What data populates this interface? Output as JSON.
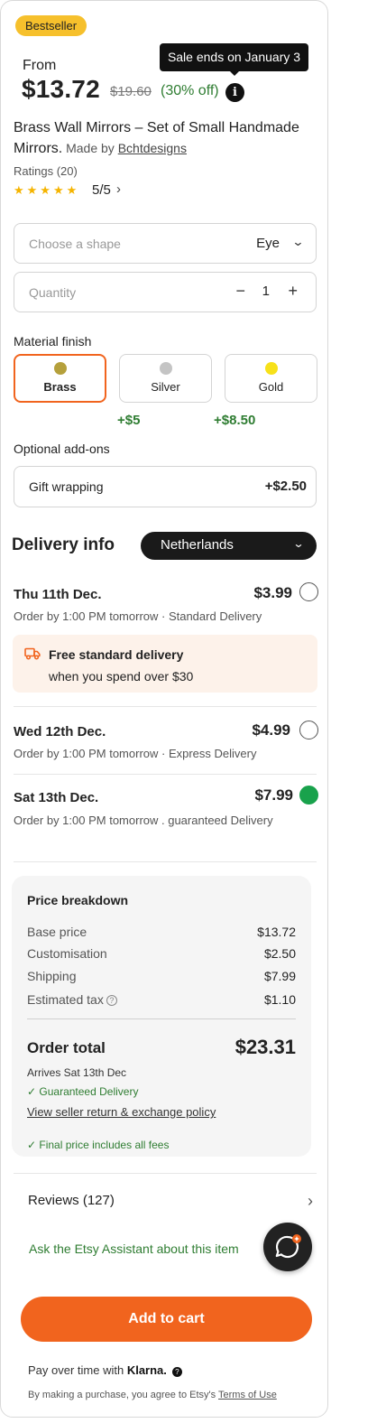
{
  "badge": "Bestseller",
  "tooltip": "Sale ends on January 3",
  "price": {
    "from_label": "From",
    "current": "$13.72",
    "original": "$19.60",
    "discount": "(30% off)",
    "info_icon": "i"
  },
  "product": {
    "title": "Brass Wall Mirrors – Set of Small Handmade Mirrors.",
    "made_by_prefix": " Made by ",
    "maker": "Bchtdesigns"
  },
  "ratings": {
    "label": "Ratings (20)",
    "stars": "★★★★★",
    "value": "5/5",
    "stars_count": 5
  },
  "shape": {
    "placeholder": "Choose a shape",
    "value": "Eye"
  },
  "quantity": {
    "placeholder": "Quantity",
    "value": "1",
    "minus": "−",
    "plus": "+"
  },
  "material": {
    "label": "Material finish",
    "options": [
      {
        "label": "Brass",
        "color": "#b5a03c",
        "selected": true
      },
      {
        "label": "Silver",
        "color": "#c4c4c4",
        "selected": false
      },
      {
        "label": "Gold",
        "color": "#f7e11a",
        "selected": false
      }
    ],
    "surcharges": [
      "+$5",
      "+$8.50"
    ]
  },
  "addons": {
    "label": "Optional add-ons",
    "items": [
      {
        "label": "Gift wrapping",
        "price": "+$2.50"
      }
    ]
  },
  "delivery": {
    "title": "Delivery info",
    "country": "Netherlands",
    "options": [
      {
        "date": "Thu 11th Dec.",
        "price": "$3.99",
        "sub": "Order by 1:00 PM tomorrow · Standard Delivery",
        "selected": false
      },
      {
        "date": "Wed 12th Dec.",
        "price": "$4.99",
        "sub": "Order by 1:00 PM tomorrow · Express Delivery",
        "selected": false
      },
      {
        "date": "Sat 13th Dec.",
        "price": "$7.99",
        "sub": "Order by 1:00 PM tomorrow . guaranteed Delivery",
        "selected": true
      }
    ],
    "promo": {
      "title": "Free standard delivery",
      "subtitle": "when you spend over $30",
      "icon": "truck-icon"
    }
  },
  "breakdown": {
    "title": "Price breakdown",
    "rows": [
      {
        "label": "Base price",
        "value": "$13.72"
      },
      {
        "label": "Customisation",
        "value": "$2.50"
      },
      {
        "label": "Shipping",
        "value": "$7.99"
      },
      {
        "label": "Estimated tax",
        "value": "$1.10"
      }
    ],
    "total_label": "Order total",
    "total_value": "$23.31",
    "arrives": "Arrives Sat 13th Dec",
    "guaranteed": "✓ Guaranteed Delivery",
    "policy_link": "View seller return & exchange policy",
    "final_note": "✓ Final price includes all fees"
  },
  "reviews": {
    "label": "Reviews (127)"
  },
  "assistant": {
    "label": "Ask the Etsy Assistant about this item"
  },
  "cart": {
    "label": "Add to cart"
  },
  "klarna": {
    "prefix": "Pay over time with ",
    "brand": "Klarna.",
    "help": "?"
  },
  "terms": {
    "prefix": "By making a purchase, you agree to Etsy's ",
    "link": "Terms of Use"
  },
  "colors": {
    "accent": "#f1641e",
    "success": "#2f7d32",
    "badge": "#f6c02c",
    "radio_selected": "#19a24c"
  }
}
